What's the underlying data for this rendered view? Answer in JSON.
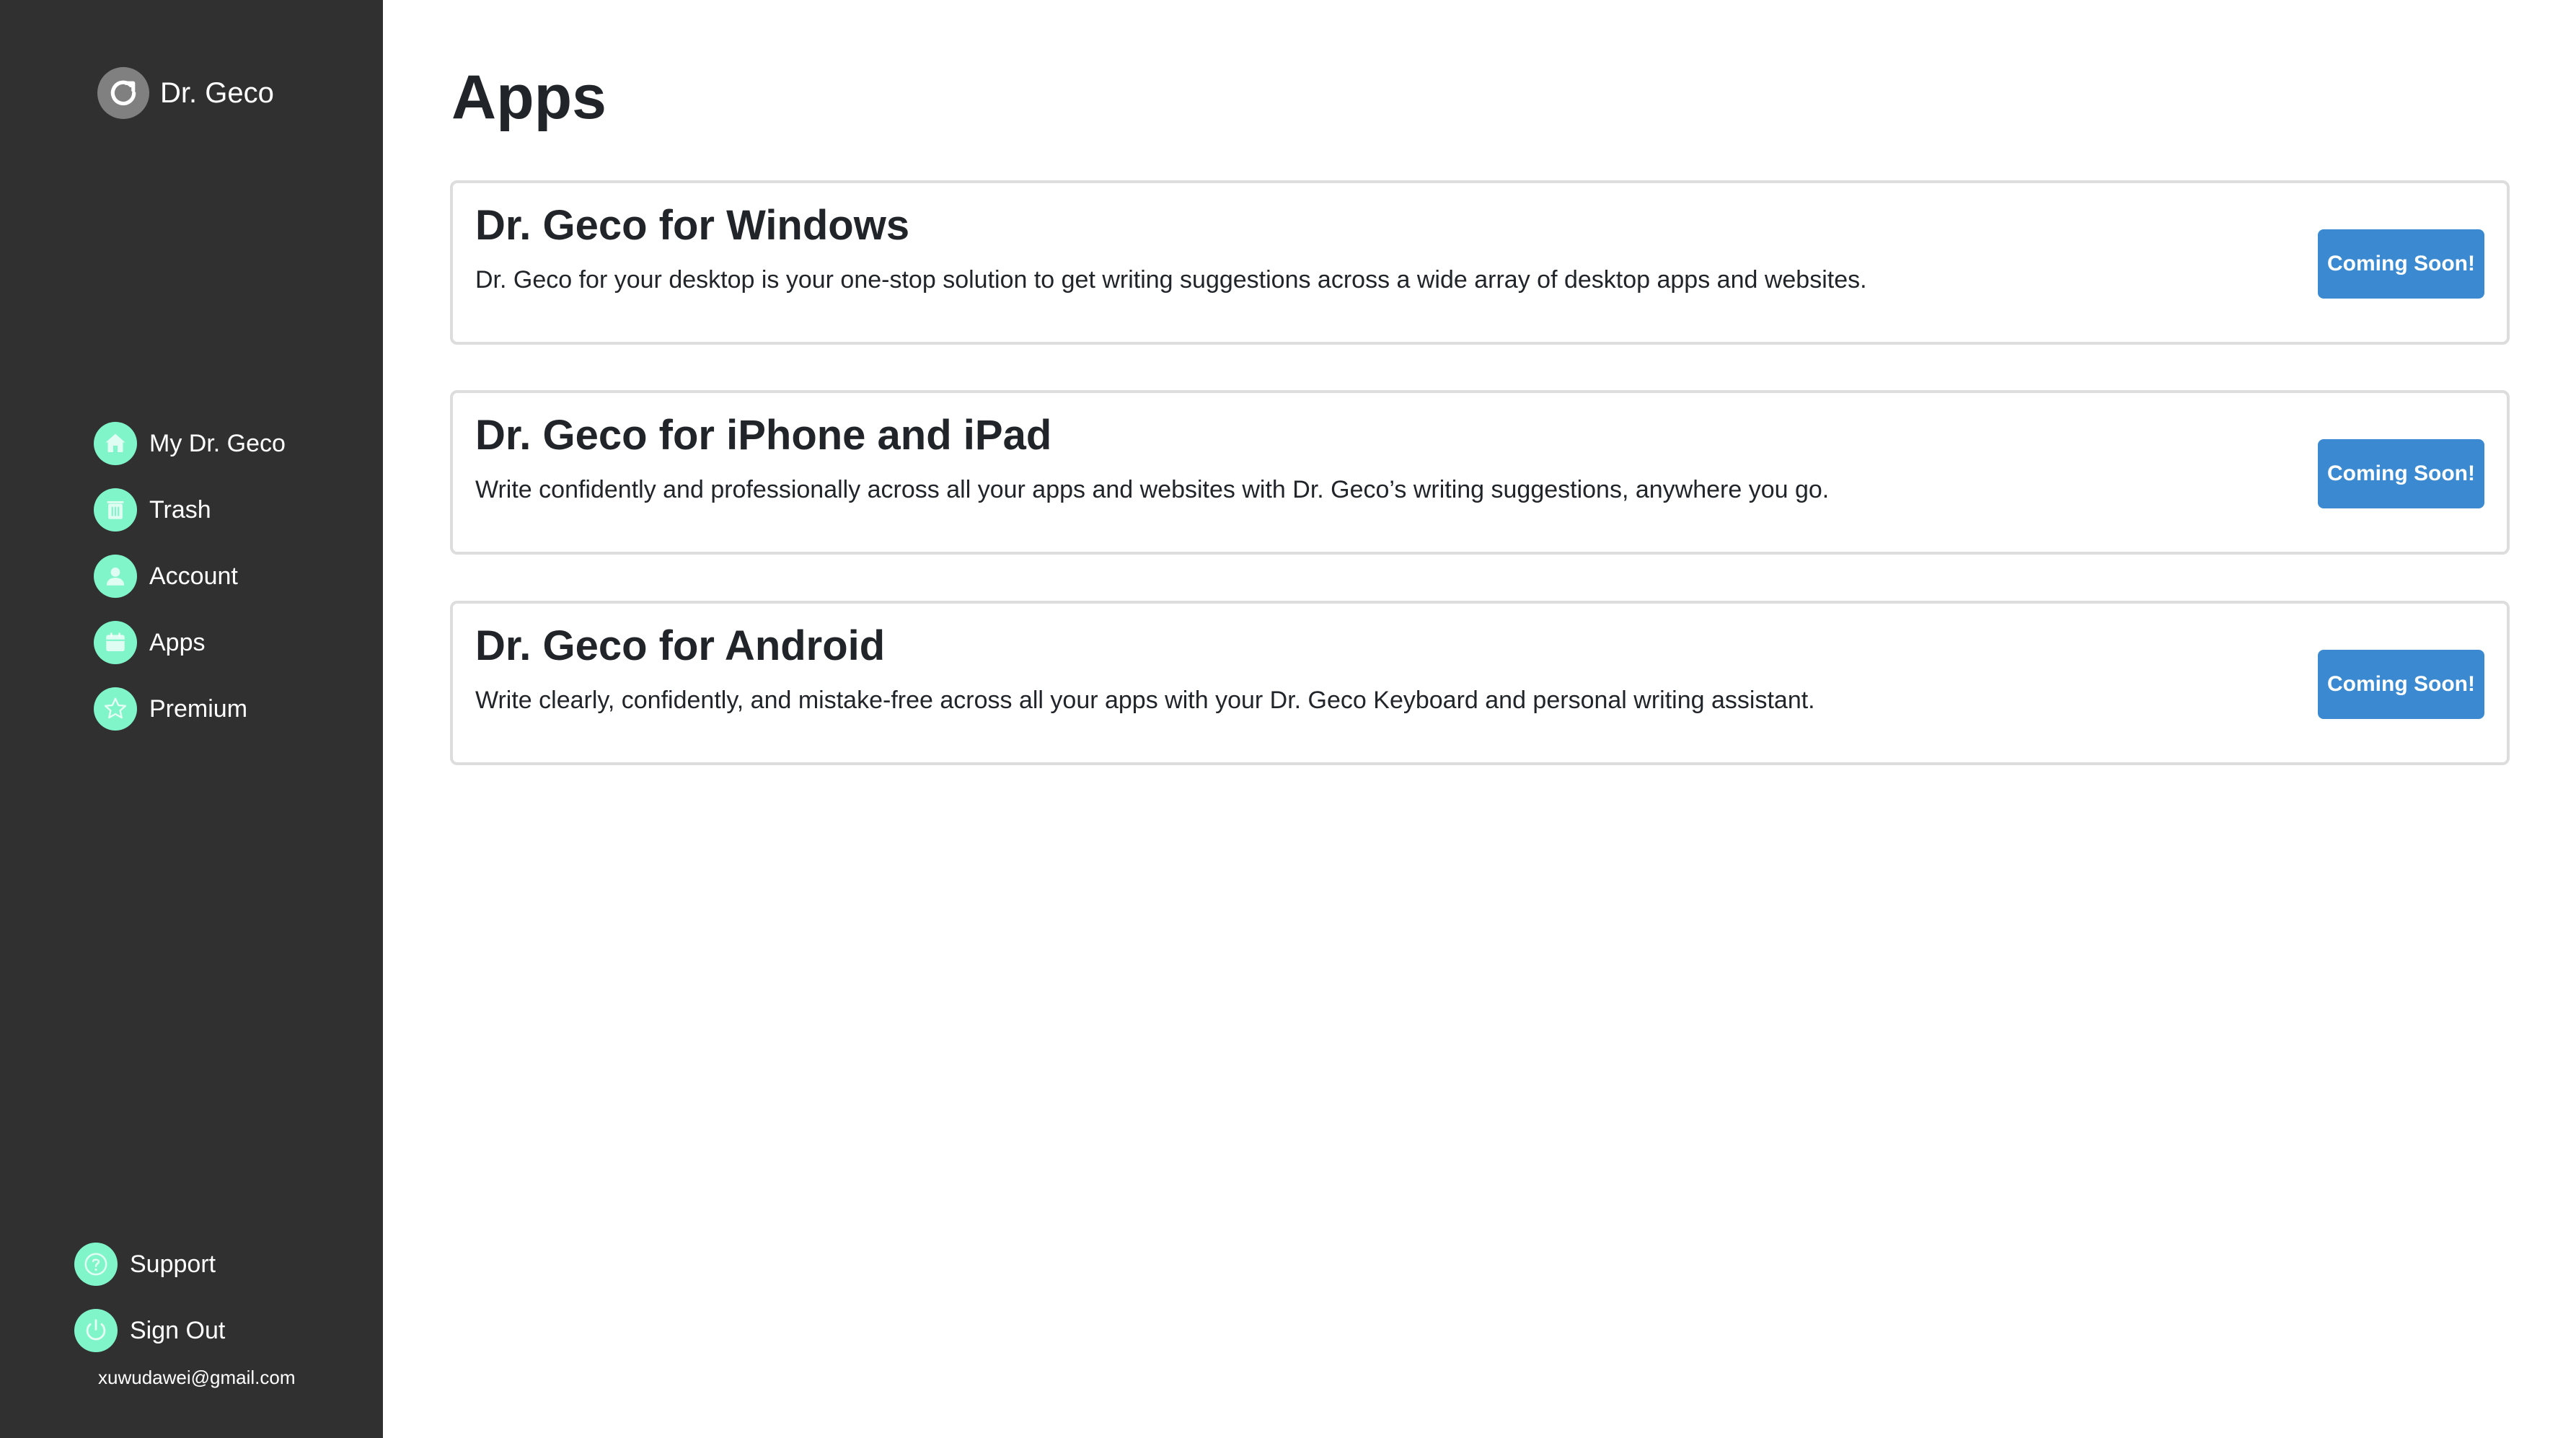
{
  "brand": {
    "name": "Dr. Geco",
    "logo_icon": "refresh-icon"
  },
  "sidebar": {
    "items": [
      {
        "label": "My Dr. Geco",
        "icon": "home-icon"
      },
      {
        "label": "Trash",
        "icon": "trash-icon"
      },
      {
        "label": "Account",
        "icon": "user-icon"
      },
      {
        "label": "Apps",
        "icon": "calendar-icon"
      },
      {
        "label": "Premium",
        "icon": "star-icon"
      }
    ],
    "bottom_items": [
      {
        "label": "Support",
        "icon": "help-icon"
      },
      {
        "label": "Sign Out",
        "icon": "power-icon"
      }
    ],
    "email": "xuwudawei@gmail.com"
  },
  "main": {
    "title": "Apps",
    "cards": [
      {
        "title": "Dr. Geco for Windows",
        "description": "Dr. Geco for your desktop is your one-stop solution to get writing suggestions across a wide array of desktop apps and websites.",
        "button": "Coming Soon!"
      },
      {
        "title": "Dr. Geco for iPhone and iPad",
        "description": "Write confidently and professionally across all your apps and websites with Dr. Geco’s writing suggestions, anywhere you go.",
        "button": "Coming Soon!"
      },
      {
        "title": "Dr. Geco for Android",
        "description": "Write clearly, confidently, and mistake-free across all your apps with your Dr. Geco Keyboard and personal writing assistant.",
        "button": "Coming Soon!"
      }
    ]
  },
  "colors": {
    "sidebar_bg": "#303030",
    "icon_accent": "#7ff5c9",
    "button_bg": "#3b8ad1",
    "text_dark": "#212529"
  }
}
